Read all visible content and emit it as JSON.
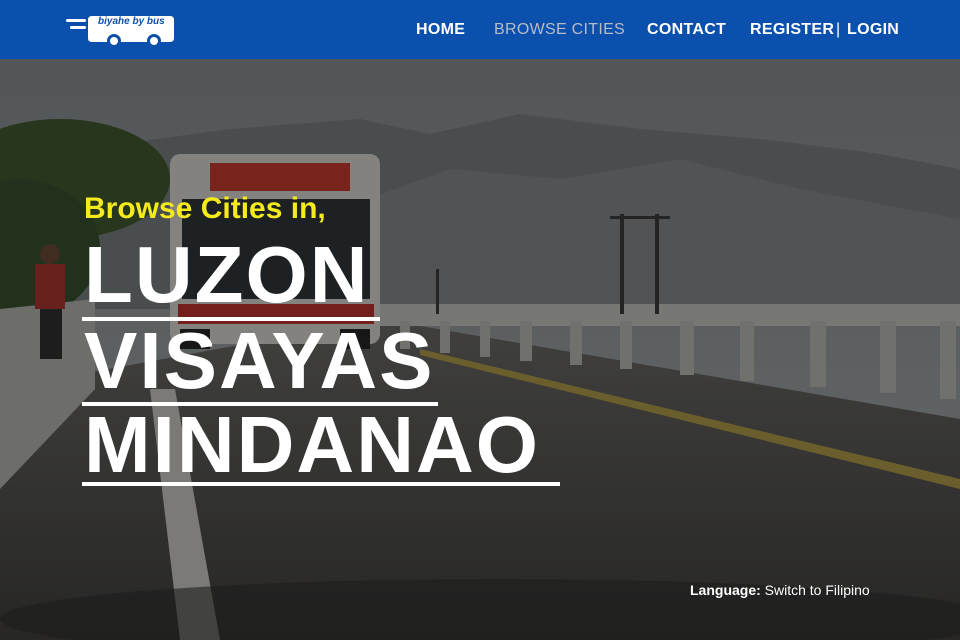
{
  "brand": {
    "logo_text": "biyahe by bus"
  },
  "nav": {
    "home": "HOME",
    "browse": "BROWSE CITIES",
    "contact": "CONTACT",
    "register": "REGISTER",
    "separator": "|",
    "login": "LOGIN"
  },
  "hero": {
    "browse_label": "Browse Cities in,",
    "regions": [
      "LUZON",
      "VISAYAS",
      "MINDANAO"
    ]
  },
  "language": {
    "label": "Language:",
    "switch": "Switch to Filipino"
  },
  "colors": {
    "navbar": "#0b50ad",
    "accent_yellow": "#f5eb1c",
    "nav_active": "#b8bcc4"
  }
}
